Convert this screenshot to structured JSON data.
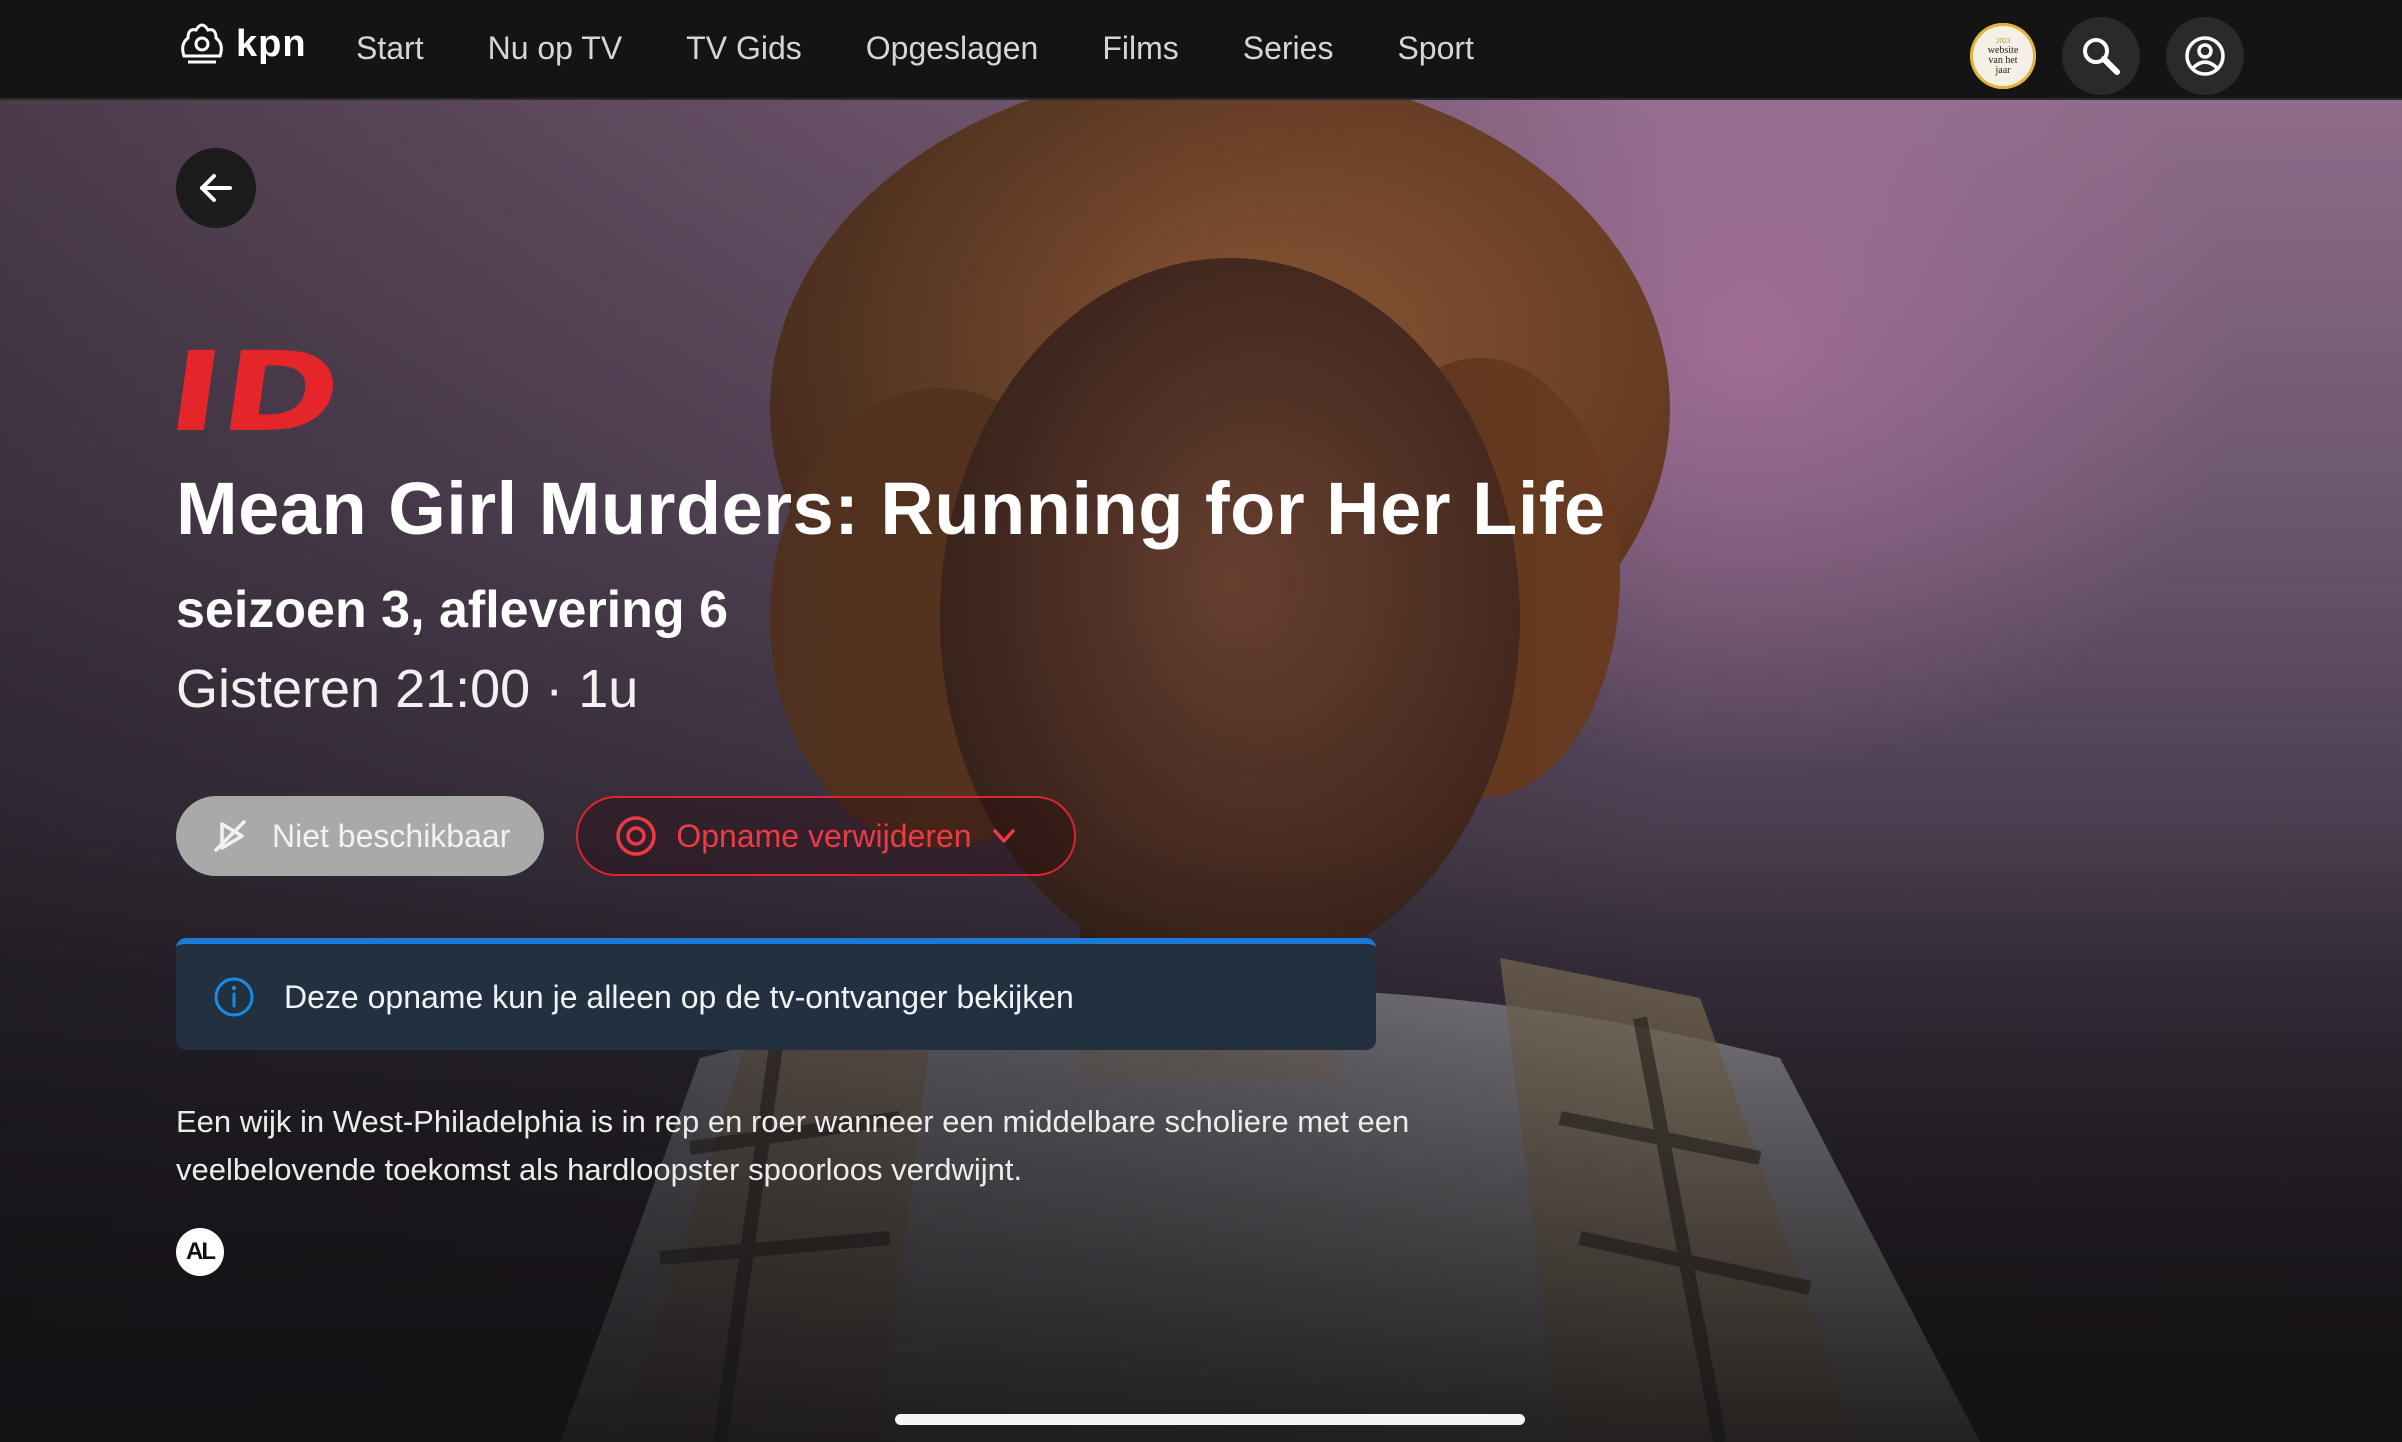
{
  "header": {
    "logo_text": "kpn",
    "nav": [
      "Start",
      "Nu op TV",
      "TV Gids",
      "Opgeslagen",
      "Films",
      "Series",
      "Sport"
    ],
    "award_badge": {
      "line1": "website",
      "line2": "van het",
      "line3": "jaar",
      "year": "2023"
    }
  },
  "program": {
    "channel_logo": "ID",
    "title": "Mean Girl Murders: Running for Her Life",
    "episode": "seizoen 3, aflevering 6",
    "schedule": "Gisteren 21:00 · 1u",
    "description": "Een wijk in West-Philadelphia is in rep en roer wanneer een middelbare scholiere met een veelbelovende toekomst als hardloopster spoorloos verdwijnt.",
    "age_rating": "AL"
  },
  "actions": {
    "unavailable_label": "Niet beschikbaar",
    "recording_label": "Opname verwijderen"
  },
  "notice": {
    "text": "Deze opname kun je alleen op de tv-ontvanger bekijken"
  },
  "colors": {
    "accent_red": "#e0242f",
    "info_blue": "#1a7ad6",
    "notice_bg": "#233040",
    "topbar_bg": "#141414"
  },
  "icons": {
    "logo": "kpn-crown-icon",
    "search": "search-icon",
    "profile": "user-profile-icon",
    "back": "arrow-left-icon",
    "unavailable": "play-slash-icon",
    "record": "record-icon",
    "dropdown": "chevron-down-icon",
    "info": "info-icon"
  }
}
